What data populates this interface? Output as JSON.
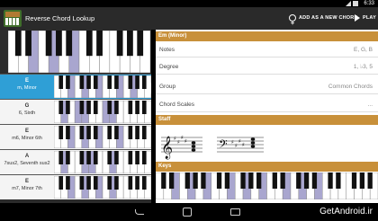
{
  "status_bar": {
    "time": "6:33"
  },
  "app": {
    "title": "Reverse Chord Lookup"
  },
  "actions": {
    "add_label": "ADD AS A NEW CHORD",
    "play_label": "PLAY"
  },
  "colors": {
    "accent_header": "#c8903a",
    "selection": "#2f9fd6",
    "key_highlight": "#a9a6cf"
  },
  "chords": [
    {
      "root": "E",
      "name": "m, Minor",
      "selected": true
    },
    {
      "root": "G",
      "name": "6, Sixth",
      "selected": false
    },
    {
      "root": "E",
      "name": "m6, Minor 6th",
      "selected": false
    },
    {
      "root": "A",
      "name": "7sus2, Seventh sus2",
      "selected": false
    },
    {
      "root": "E",
      "name": "m7, Minor 7th",
      "selected": false
    }
  ],
  "detail": {
    "header": "Em (Minor)",
    "rows": [
      {
        "key": "Notes",
        "value": "E, G, B"
      },
      {
        "key": "Degree",
        "value": "1, ♭3, 5"
      },
      {
        "key": "Group",
        "value": "Common Chords"
      },
      {
        "key": "Chord Scales",
        "value": "..."
      }
    ],
    "staff_header": "Staff",
    "keys_header": "Keys"
  },
  "watermark": "GetAndroid.ir"
}
